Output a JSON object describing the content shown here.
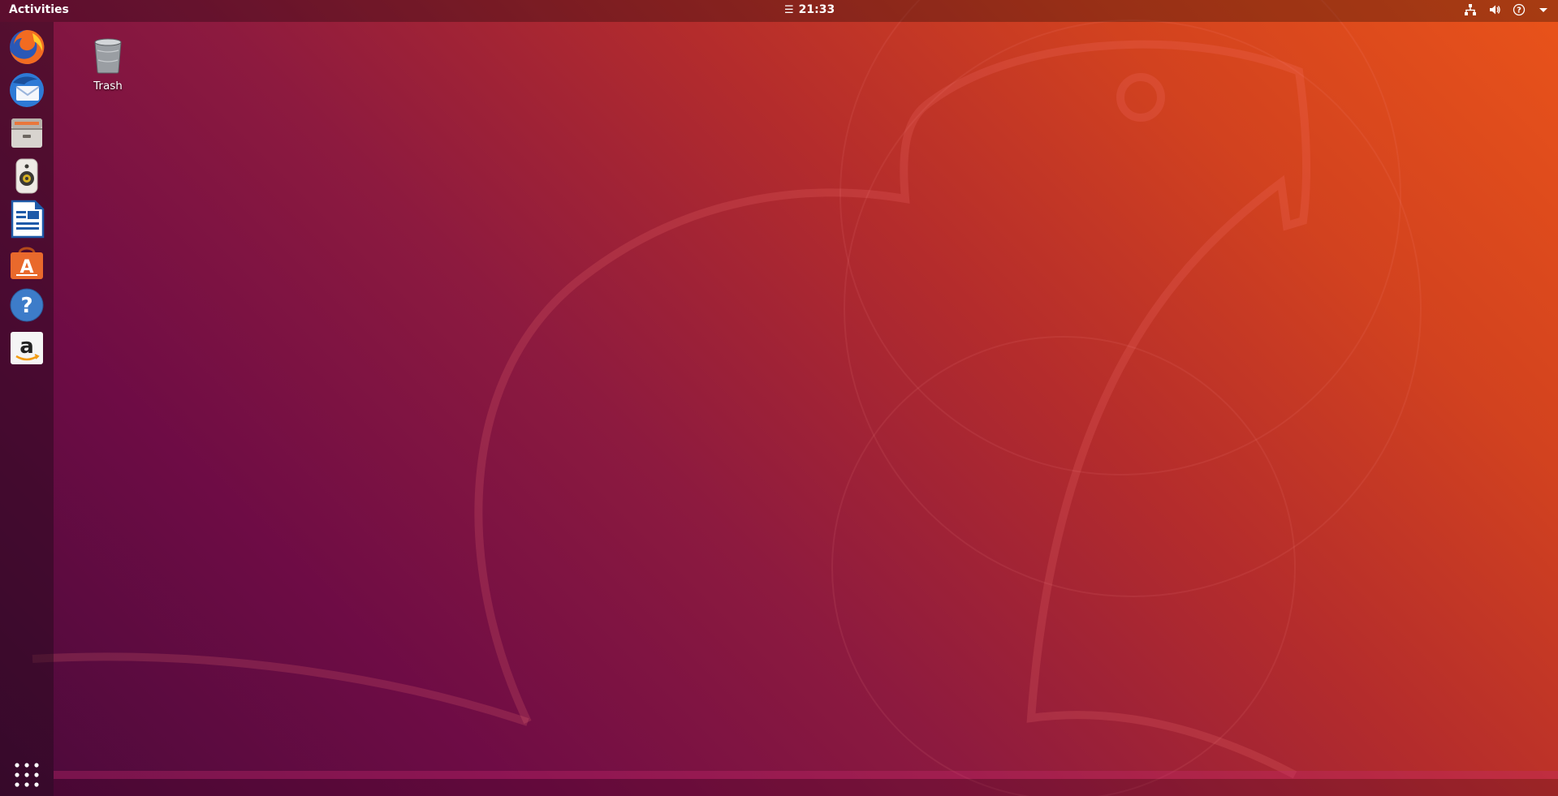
{
  "top_bar": {
    "activities_label": "Activities",
    "clock": "21:33",
    "menu_glyph": "☰",
    "tray_icons": [
      "network-icon",
      "volume-icon",
      "accessibility-icon",
      "system-menu-icon"
    ]
  },
  "dock": {
    "apps": [
      {
        "name": "firefox-icon"
      },
      {
        "name": "thunderbird-icon"
      },
      {
        "name": "files-icon"
      },
      {
        "name": "rhythmbox-icon"
      },
      {
        "name": "libreoffice-writer-icon"
      },
      {
        "name": "ubuntu-software-icon"
      },
      {
        "name": "help-icon"
      },
      {
        "name": "amazon-icon"
      }
    ],
    "show_apps": "show-applications-icon"
  },
  "desktop": {
    "icons": [
      {
        "label": "Trash",
        "icon": "trash-icon"
      }
    ]
  },
  "colors": {
    "wallpaper_dark": "#4a0a3a",
    "wallpaper_mid": "#b42c2c",
    "wallpaper_light": "#e9531a",
    "top_bar_text": "#ffffff"
  }
}
